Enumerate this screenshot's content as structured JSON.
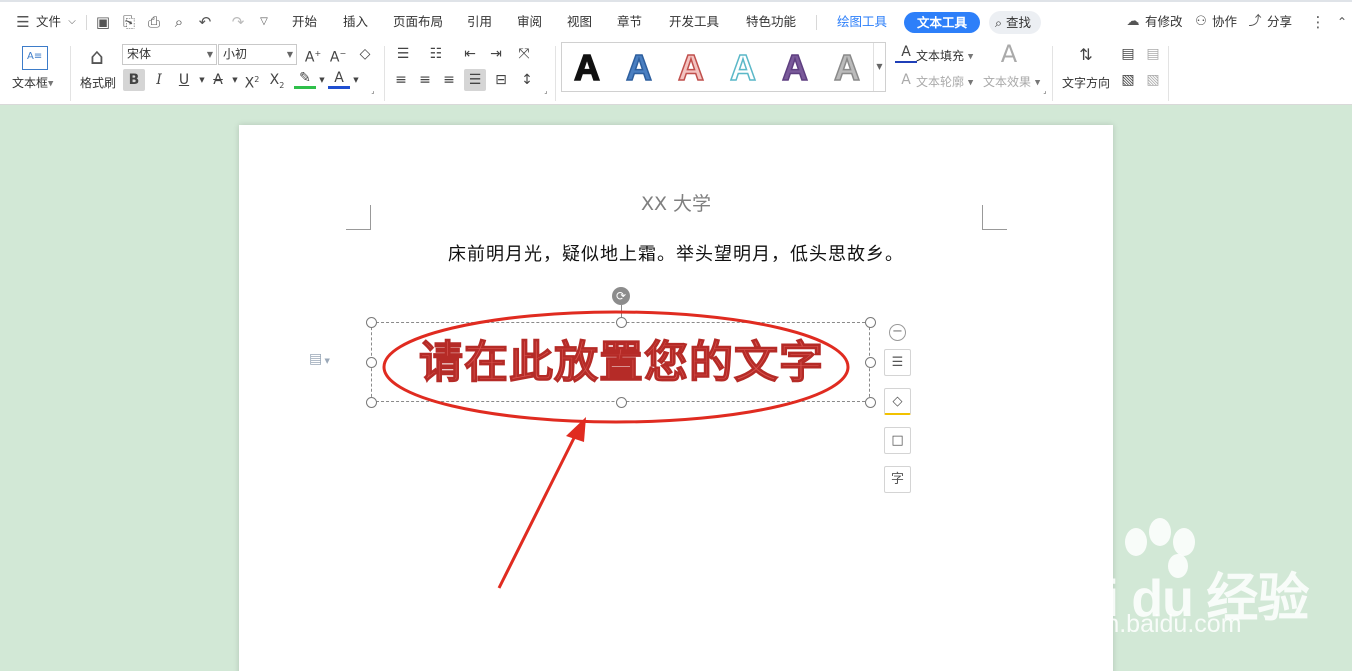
{
  "menu": {
    "file": "文件",
    "tabs": [
      {
        "label": "开始"
      },
      {
        "label": "插入"
      },
      {
        "label": "页面布局"
      },
      {
        "label": "引用"
      },
      {
        "label": "审阅"
      },
      {
        "label": "视图"
      },
      {
        "label": "章节"
      },
      {
        "label": "开发工具"
      },
      {
        "label": "特色功能"
      }
    ],
    "draw_tools": "绘图工具",
    "text_tools": "文本工具",
    "search": "查找",
    "has_changes": "有修改",
    "collab": "协作",
    "share": "分享"
  },
  "ribbon": {
    "textbox": "文本框",
    "format_painter": "格式刷",
    "font_name": "宋体",
    "font_size": "小初",
    "text_fill": "文本填充",
    "text_outline": "文本轮廓",
    "text_effect": "文本效果",
    "text_direction": "文字方向",
    "styles": [
      {
        "glyph": "A",
        "fill": "#111111",
        "stroke": "#111111"
      },
      {
        "glyph": "A",
        "fill": "#4a7fc1",
        "stroke": "#2e5f9e"
      },
      {
        "glyph": "A",
        "fill": "#f3c3c0",
        "stroke": "#c0504d"
      },
      {
        "glyph": "A",
        "fill": "#ffffff",
        "stroke": "#5bb8c8"
      },
      {
        "glyph": "A",
        "fill": "#7a5a9a",
        "stroke": "#5e3f80"
      },
      {
        "glyph": "A",
        "fill": "#bbbbbb",
        "stroke": "#8a8a8a"
      }
    ]
  },
  "document": {
    "header": "XX 大学",
    "poem": "床前明月光，疑似地上霜。举头望明月，低头思故乡。",
    "wordart": "请在此放置您的文字"
  },
  "side_tools": {
    "layout_glyph": "☰",
    "fill_glyph": "◇",
    "outline_glyph": "□",
    "text_glyph": "字"
  },
  "watermark": {
    "brand": "Bai du 经验",
    "url": "jingyan.baidu.com"
  },
  "colors": {
    "accent": "#2d7ff9",
    "annotation": "#e02b20",
    "wordart": "#d9534f",
    "workspace": "#d2e8d6"
  }
}
